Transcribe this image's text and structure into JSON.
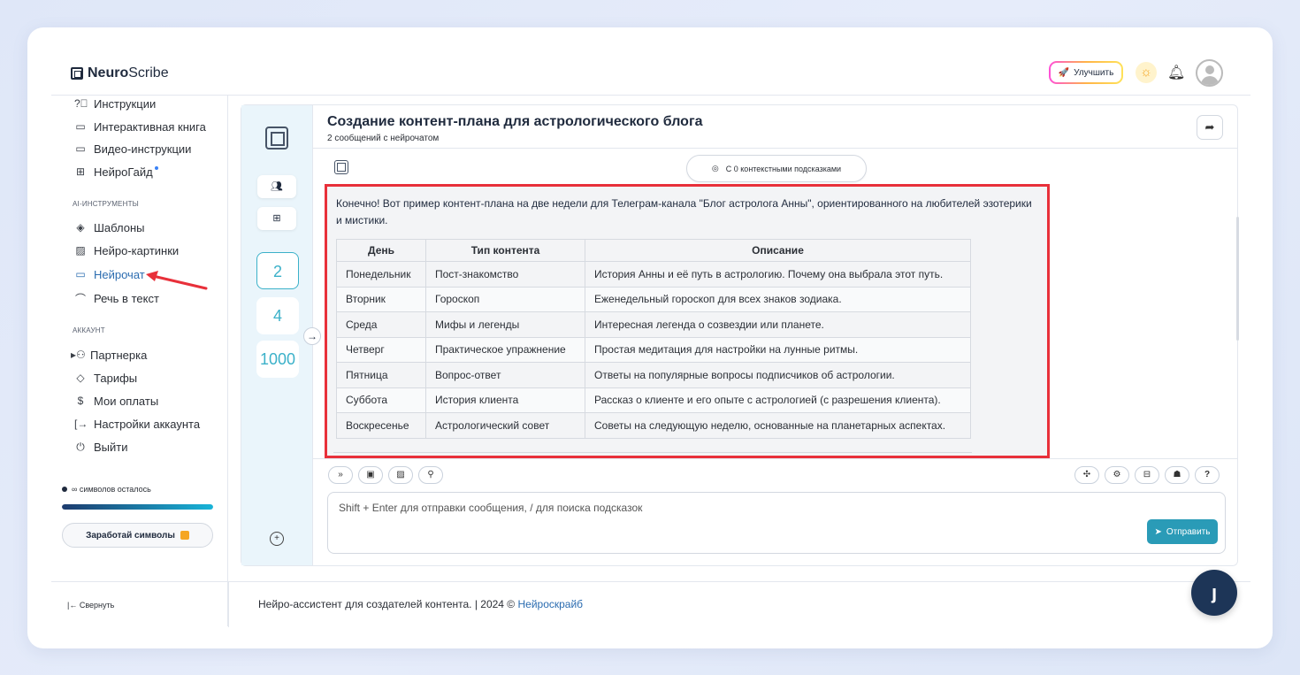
{
  "header": {
    "logo_bold": "Neuro",
    "logo_rest": "Scribe",
    "upgrade_label": "Улучшить"
  },
  "sidebar": {
    "items_top": [
      {
        "icon": "question-circle-icon",
        "label": "Инструкции"
      },
      {
        "icon": "book-icon",
        "label": "Интерактивная книга"
      },
      {
        "icon": "video-icon",
        "label": "Видео-инструкции"
      },
      {
        "icon": "guide-icon",
        "label": "НейроГайд"
      }
    ],
    "section_ai": "AI-ИНСТРУМЕНТЫ",
    "items_ai": [
      {
        "icon": "layers-icon",
        "label": "Шаблоны"
      },
      {
        "icon": "image-icon",
        "label": "Нейро-картинки"
      },
      {
        "icon": "chat-icon",
        "label": "Нейрочат"
      },
      {
        "icon": "headphones-icon",
        "label": "Речь в текст"
      }
    ],
    "section_account": "АККАУНТ",
    "items_account": [
      {
        "icon": "users-icon",
        "label": "Партнерка"
      },
      {
        "icon": "tag-icon",
        "label": "Тарифы"
      },
      {
        "icon": "dollar-icon",
        "label": "Мои оплаты"
      },
      {
        "icon": "settings-arrow-icon",
        "label": "Настройки аккаунта"
      },
      {
        "icon": "power-icon",
        "label": "Выйти"
      }
    ],
    "symbols_left": "∞ символов осталось",
    "symbols_progress": 1.0,
    "earn_button": "Заработай символы"
  },
  "chat": {
    "title": "Создание контент-плана для астрологического блога",
    "subtitle": "2 сообщений с нейрочатом",
    "context_hint": "С 0 контекстными подсказками",
    "rail_numbers": [
      "2",
      "4",
      "1000"
    ],
    "message_intro": "Конечно! Вот пример контент-плана на две недели для Телеграм-канала \"Блог астролога Анны\", ориентированного на любителей эзотерики и мистики.",
    "table": {
      "headers": [
        "День",
        "Тип контента",
        "Описание"
      ],
      "rows": [
        [
          "Понедельник",
          "Пост-знакомство",
          "История Анны и её путь в астрологию. Почему она выбрала этот путь."
        ],
        [
          "Вторник",
          "Гороскоп",
          "Еженедельный гороскоп для всех знаков зодиака."
        ],
        [
          "Среда",
          "Мифы и легенды",
          "Интересная легенда о созвездии или планете."
        ],
        [
          "Четверг",
          "Практическое упражнение",
          "Простая медитация для настройки на лунные ритмы."
        ],
        [
          "Пятница",
          "Вопрос-ответ",
          "Ответы на популярные вопросы подписчиков об астрологии."
        ],
        [
          "Суббота",
          "История клиента",
          "Рассказ о клиенте и его опыте с астрологией (с разрешения клиента)."
        ],
        [
          "Воскресенье",
          "Астрологический совет",
          "Советы на следующую неделю, основанные на планетарных аспектах."
        ]
      ]
    },
    "input_placeholder": "Shift + Enter для отправки сообщения, / для поиска подсказок",
    "send_label": "Отправить"
  },
  "footer": {
    "collapse_label": "Свернуть",
    "copyright_text": "Нейро-ассистент для создателей контента.  | 2024 © ",
    "copyright_link": "Нейроскрайб"
  },
  "colors": {
    "accent": "#2a9bb7",
    "highlight_border": "#e8303a",
    "dark": "#1d3557"
  }
}
